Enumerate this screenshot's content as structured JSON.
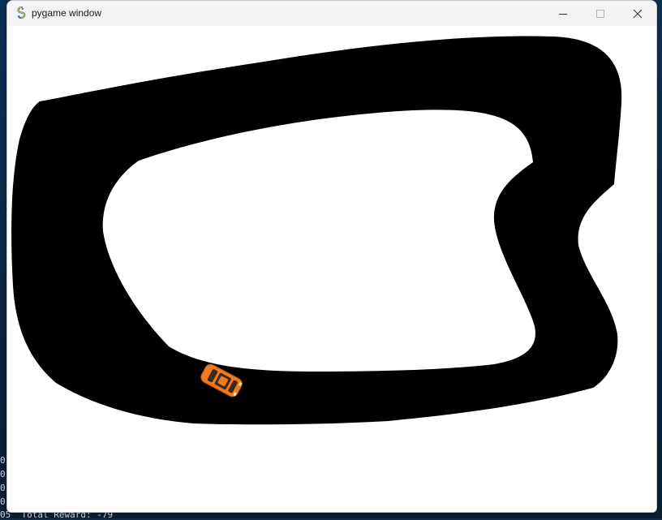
{
  "window": {
    "title": "pygame window",
    "icon": "pygame-snake-icon",
    "controls": [
      "minimize-icon",
      "maximize-icon",
      "close-icon"
    ]
  },
  "terminal": {
    "lines": [
      "0",
      "0",
      "0",
      "0",
      "05  Total Reward: -79"
    ]
  },
  "scene": {
    "track_color": "#000000",
    "background_color": "#ffffff",
    "car_color": "#f07a1e"
  }
}
